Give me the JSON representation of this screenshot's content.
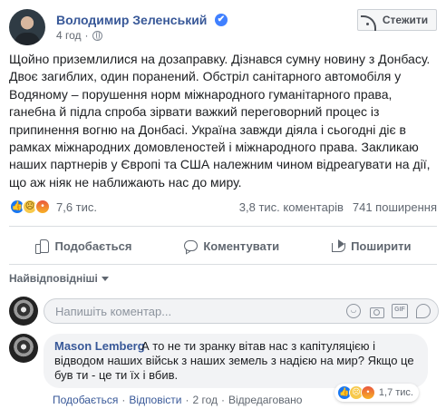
{
  "post": {
    "author": "Володимир Зеленський",
    "verified_mark": "✔",
    "time": "4 год",
    "follow_label": "Стежити",
    "text": "Щойно приземлилися на дозаправку. Дізнався сумну новину з Донбасу. Двоє загиблих, один поранений. Обстріл санітарного автомобіля у Водяному – порушення норм міжнародного гуманітарного права, ганебна й підла спроба зірвати важкий переговорний процес із припинення вогню на Донбасі. Україна завжди діяла і сьогодні діє в рамках міжнародних домовленостей і міжнародного права. Закликаю наших партнерів у Європі та США належним чином відреагувати на дії, що аж ніяк не наближають нас до миру.",
    "reaction_icons": [
      "like-icon",
      "sad-icon",
      "angry-icon"
    ],
    "reaction_count": "7,6 тис.",
    "comments_count": "3,8 тис. коментарів",
    "shares_count": "741 поширення"
  },
  "actions": {
    "like": "Подобається",
    "comment": "Коментувати",
    "share": "Поширити"
  },
  "comments_section": {
    "sort_label": "Найвідповідніші",
    "input_placeholder": "Напишіть коментар...",
    "gif_label": "GIF"
  },
  "comment": {
    "author": "Mason Lemberg",
    "text": "А то не ти зранку вітав нас з капітуляцією і відводом наших військ з наших земель з надією на мир? Якщо це був ти - це ти їх і вбив.",
    "like_label": "Подобається",
    "sep1": "·",
    "reply_label": "Відповісти",
    "sep2": "·",
    "time": "2 год",
    "sep3": "·",
    "edited_label": "Відредаговано",
    "reaction_count": "1,7 тис."
  },
  "colors": {
    "link_blue": "#385898",
    "like_blue": "#1877f2",
    "divider": "#dadde1"
  }
}
